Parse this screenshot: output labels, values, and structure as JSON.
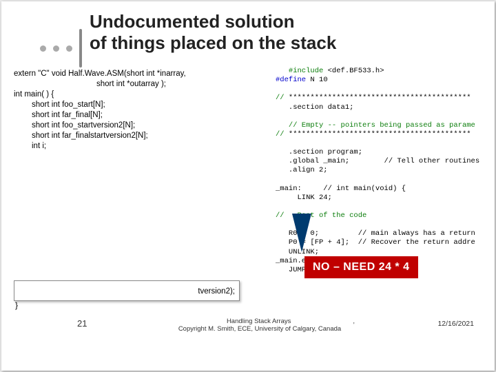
{
  "title": {
    "line1": "Undocumented solution",
    "line2": "of things placed on the stack"
  },
  "left": {
    "l1": "extern \"C\" void Half.Wave.ASM(short int *inarray,",
    "l2": "short int *outarray );",
    "l3": "int main( ) {",
    "l4": "short int foo_start[N];",
    "l5": "short int far_final[N];",
    "l6": "short int foo_startversion2[N];",
    "l7": "short int far_finalstartversion2[N];",
    "l8": "int i;",
    "tail": "tversion2);",
    "brace": "}"
  },
  "right": {
    "r1a": "   #include ",
    "r1b": "<def.BF533.h>",
    "r2a": "#define",
    "r2b": " N 10",
    "r3a": "// ",
    "r3b": "******************************************",
    "r4": "   .section data1;",
    "r5": "   // Empty -- pointers being passed as parame",
    "r6a": "// ",
    "r6b": "******************************************",
    "r7": "   .section program;",
    "r8": "   .global _main;        // Tell other routines",
    "r9": "   .align 2;",
    "r10": "_main:     // int main(void) {",
    "r11": "     LINK 24;",
    "r12": "//   Rest of the code",
    "r13": "   R0 = 0;         // main always has a return",
    "r14": "   P0 = [FP + 4];  // Recover the return addre",
    "r15": "   UNLINK;",
    "r16": "_main.end:",
    "r17": "   JUMP (P0);      // }    main"
  },
  "no_box": "NO – NEED 24 * 4",
  "footer": {
    "num": "21",
    "center_l1": "Handling Stack Arrays",
    "center_l2": "Copyright M. Smith, ECE, University of Calgary, Canada",
    "marker": ",",
    "date": "12/16/2021"
  }
}
